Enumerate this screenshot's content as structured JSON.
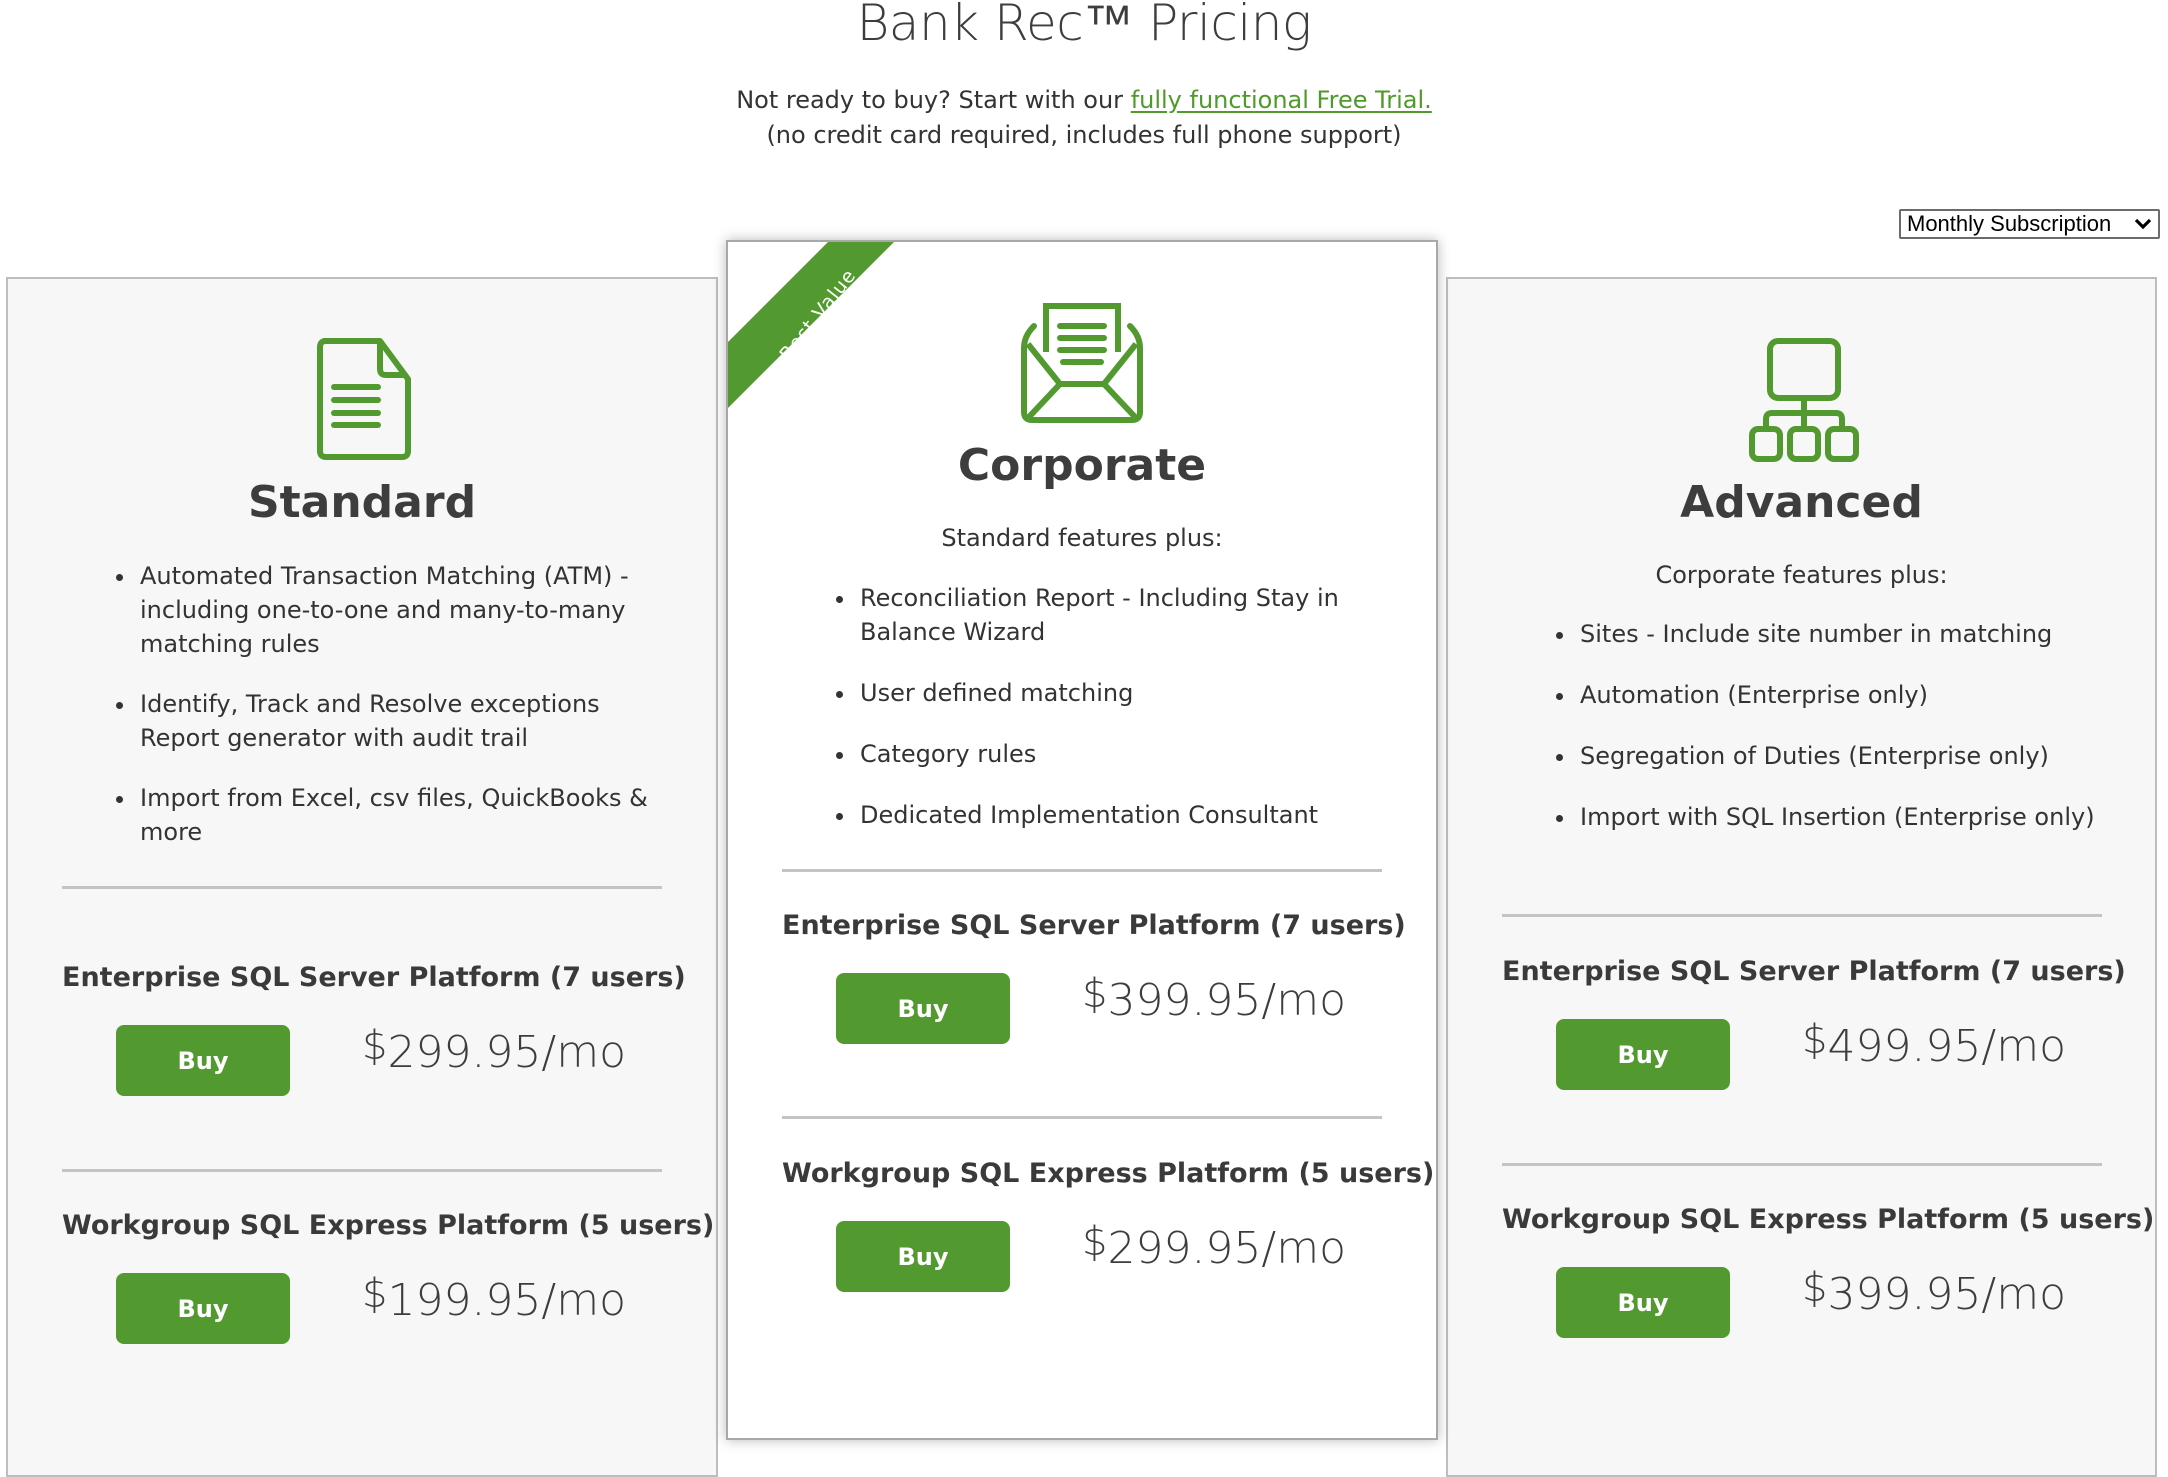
{
  "page": {
    "title": "Bank Rec™ Pricing",
    "intro_text": "Not ready to buy? Start with our ",
    "trial_link": "fully functional Free Trial.",
    "intro_note": "(no credit card required, includes full phone support)"
  },
  "billing_select": {
    "selected": "Monthly Subscription",
    "icon": "chevron-down-icon"
  },
  "colors": {
    "accent_green": "#529a30",
    "card_bg": "#f7f7f7",
    "text": "#3a3a3a"
  },
  "plans": [
    {
      "name": "Standard",
      "icon": "document-icon",
      "intro": "",
      "features": [
        "Automated Transaction Matching (ATM) - including one-to-one and many-to-many matching rules",
        "Identify, Track and Resolve exceptions Report generator with audit trail",
        "Import from Excel, csv files, QuickBooks & more"
      ],
      "tiers": [
        {
          "name": "Enterprise SQL Server Platform (7 users)",
          "button": "Buy",
          "currency": "$",
          "price": "299.95",
          "period": "/mo"
        },
        {
          "name": "Workgroup SQL Express Platform (5 users)",
          "button": "Buy",
          "currency": "$",
          "price": "199.95",
          "period": "/mo"
        }
      ]
    },
    {
      "name": "Corporate",
      "icon": "envelope-open-icon",
      "badge": "Best Value",
      "intro": "Standard features plus:",
      "features": [
        "Reconciliation Report - Including Stay in Balance Wizard",
        "User defined matching",
        "Category rules",
        "Dedicated Implementation Consultant"
      ],
      "tiers": [
        {
          "name": "Enterprise SQL Server Platform (7 users)",
          "button": "Buy",
          "currency": "$",
          "price": "399.95",
          "period": "/mo"
        },
        {
          "name": "Workgroup SQL Express Platform (5 users)",
          "button": "Buy",
          "currency": "$",
          "price": "299.95",
          "period": "/mo"
        }
      ]
    },
    {
      "name": "Advanced",
      "icon": "hierarchy-icon",
      "intro": "Corporate features plus:",
      "features": [
        "Sites - Include site number in matching",
        "Automation (Enterprise only)",
        "Segregation of Duties (Enterprise only)",
        "Import with SQL Insertion (Enterprise only)"
      ],
      "tiers": [
        {
          "name": "Enterprise SQL Server Platform (7 users)",
          "button": "Buy",
          "currency": "$",
          "price": "499.95",
          "period": "/mo"
        },
        {
          "name": "Workgroup SQL Express Platform (5 users)",
          "button": "Buy",
          "currency": "$",
          "price": "399.95",
          "period": "/mo"
        }
      ]
    }
  ]
}
